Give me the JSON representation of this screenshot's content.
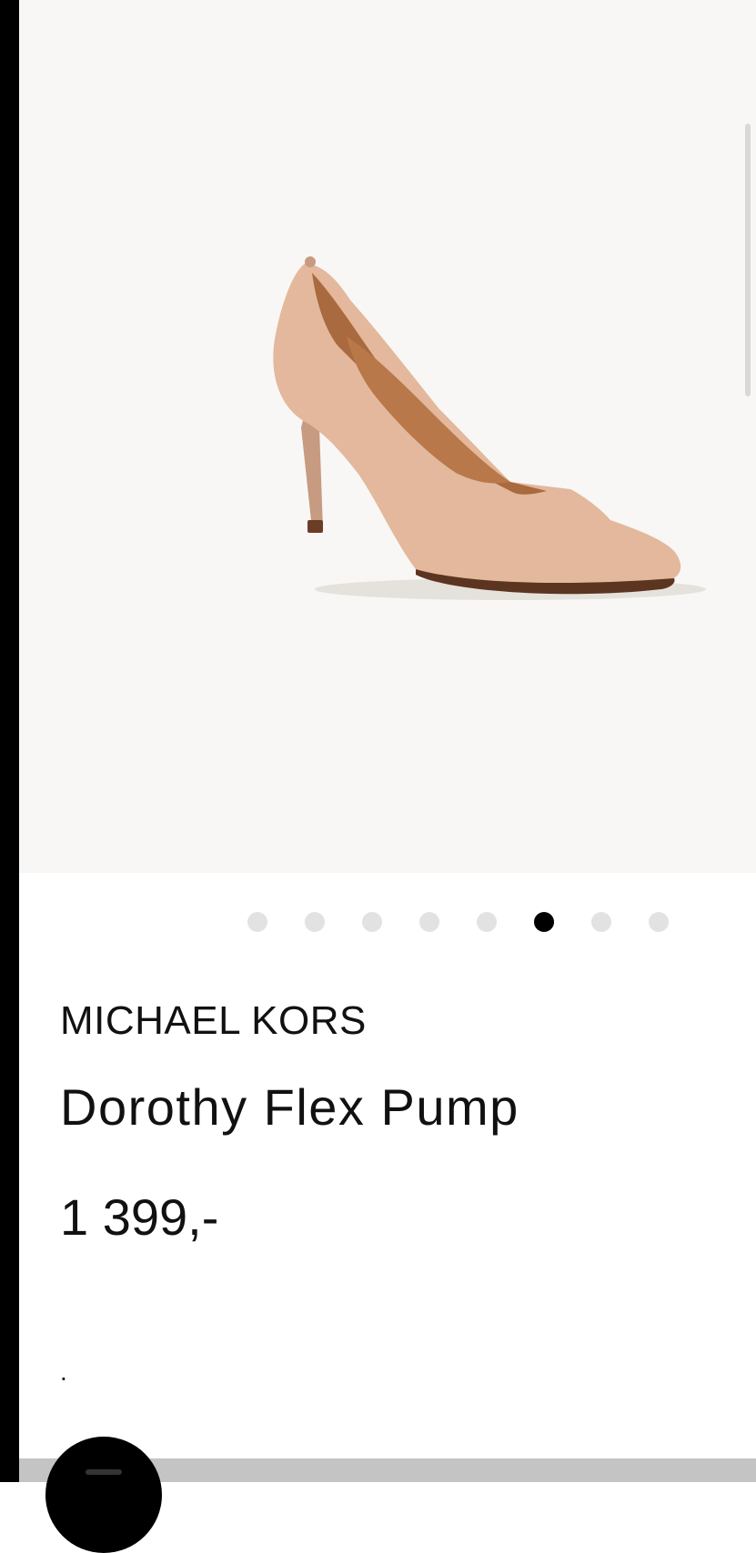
{
  "product": {
    "brand": "MICHAEL KORS",
    "name": "Dorothy Flex Pump",
    "price": "1 399,-",
    "note": "."
  },
  "gallery": {
    "image_count": 8,
    "active_index": 5
  },
  "colors": {
    "hero_background": "#f8f7f5",
    "shoe_color": "#e2b89c",
    "dot_inactive": "#e2e2e2",
    "dot_active": "#000000"
  },
  "icons": {
    "fab": "menu-icon"
  }
}
